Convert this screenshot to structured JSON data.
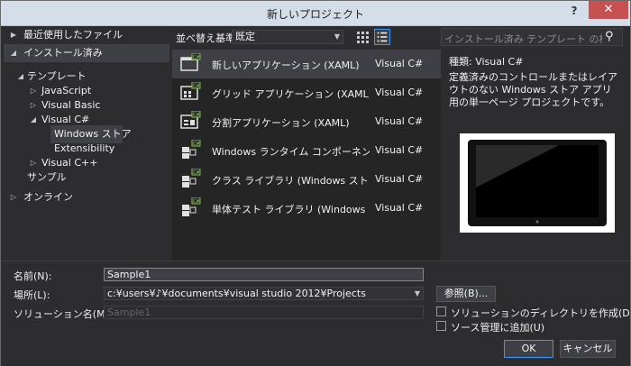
{
  "title": "新しいプロジェクト",
  "window_buttons": {
    "help": "?",
    "close": "✕"
  },
  "tree": {
    "recent": "最近使用したファイル",
    "installed": "インストール済み",
    "templates": "テンプレート",
    "javascript": "JavaScript",
    "visual_basic": "Visual Basic",
    "visual_csharp": "Visual C#",
    "windows_store": "Windows ストア",
    "extensibility": "Extensibility",
    "visual_cpp": "Visual C++",
    "samples": "サンプル",
    "online": "オンライン"
  },
  "sort": {
    "label": "並べ替え基準:",
    "value": "既定"
  },
  "templates": [
    {
      "name": "新しいアプリケーション (XAML)",
      "lang": "Visual C#"
    },
    {
      "name": "グリッド アプリケーション (XAML)",
      "lang": "Visual C#"
    },
    {
      "name": "分割アプリケーション (XAML)",
      "lang": "Visual C#"
    },
    {
      "name": "Windows ランタイム コンポーネント",
      "lang": "Visual C#"
    },
    {
      "name": "クラス ライブラリ (Windows ストア アプリ)",
      "lang": "Visual C#"
    },
    {
      "name": "単体テスト ライブラリ (Windows ストア ア…",
      "lang": "Visual C#"
    }
  ],
  "search": {
    "placeholder": "インストール済み テンプレート の検索 (Ctrl"
  },
  "detail": {
    "type_label": "種類:",
    "type_value": "Visual C#",
    "description": "定義済みのコントロールまたはレイアウトのない Windows ストア アプリ用の単一ページ プロジェクトです。"
  },
  "form": {
    "name_label": "名前(N):",
    "name_value": "Sample1",
    "location_label": "場所(L):",
    "location_value": "c:¥users¥♪¥documents¥visual studio 2012¥Projects",
    "solution_label": "ソリューション名(M):",
    "solution_value": "Sample1",
    "browse": "参照(B)...",
    "create_dir": "ソリューションのディレクトリを作成(D)",
    "source_control": "ソース管理に追加(U)",
    "ok": "OK",
    "cancel": "キャンセル"
  },
  "colors": {
    "accent": "#3399ff",
    "background": "#2d2d30",
    "list_bg": "#252526",
    "close": "#c75050"
  }
}
